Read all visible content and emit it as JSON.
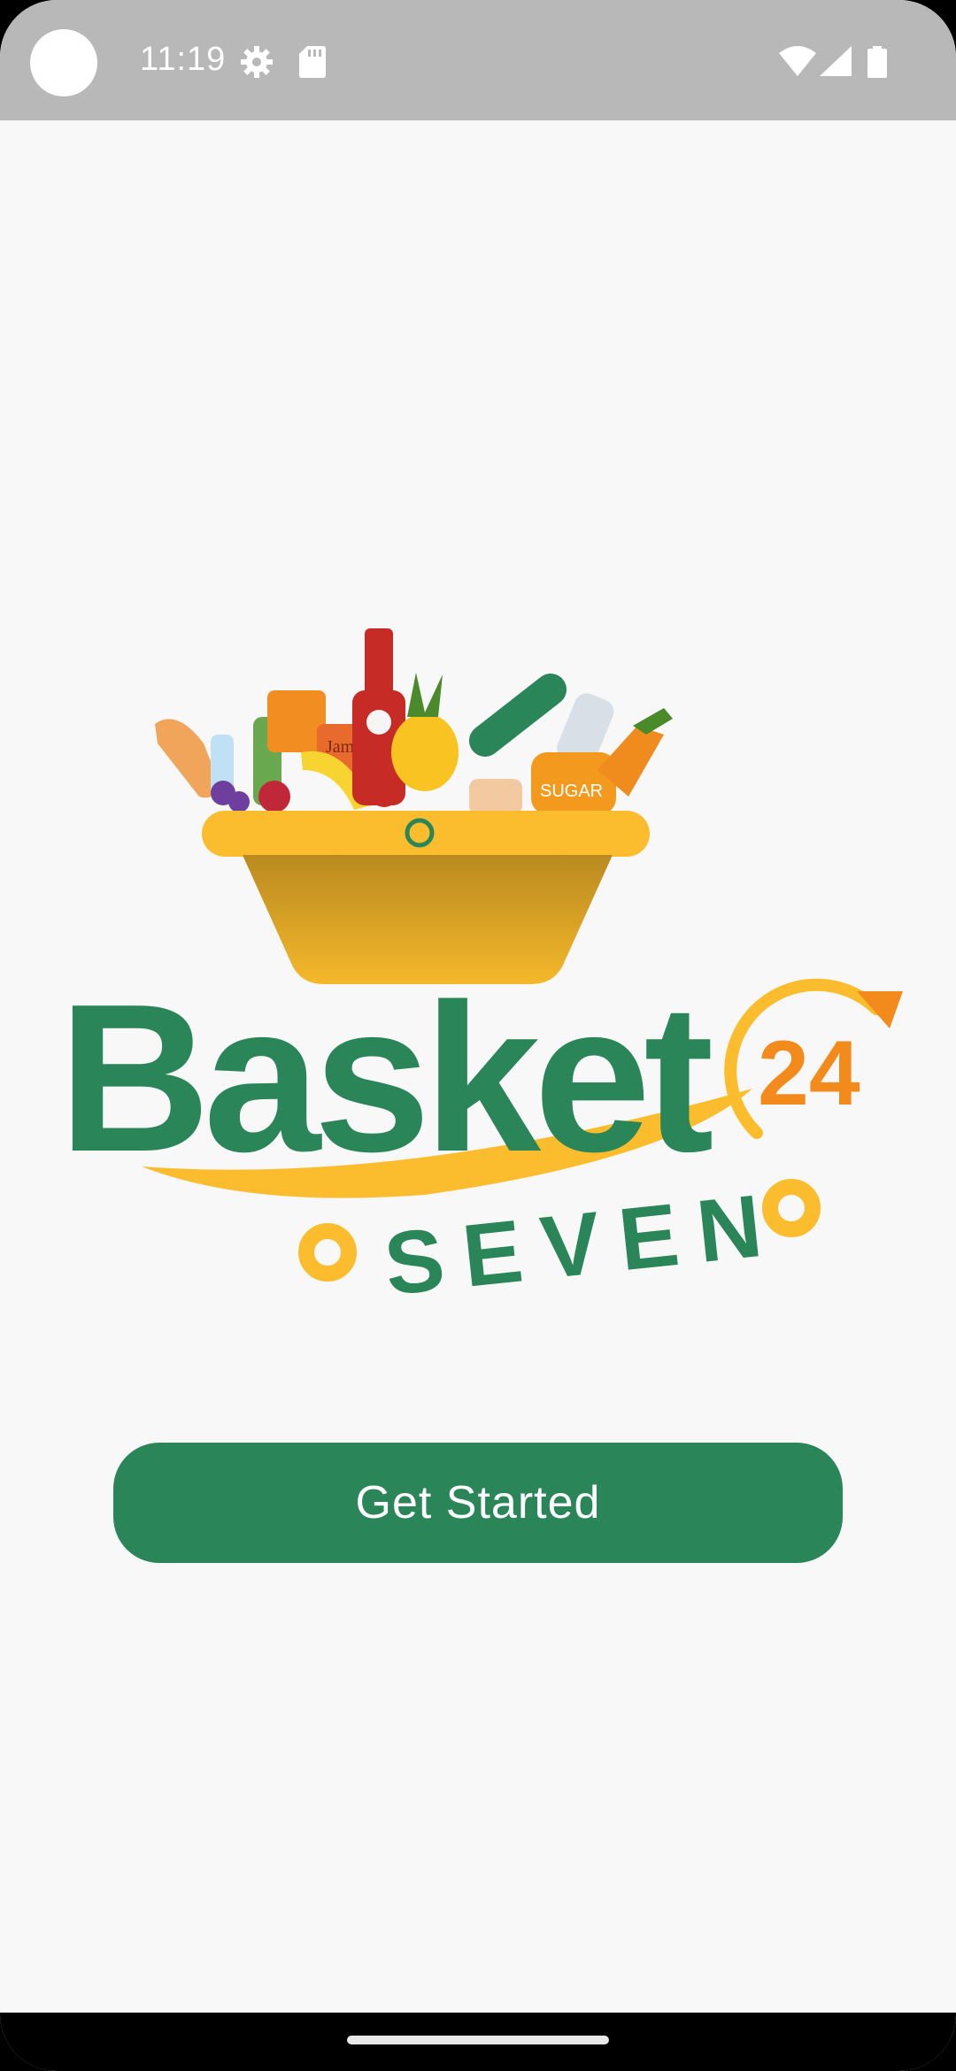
{
  "status_bar": {
    "time": "11:19",
    "icons": [
      "gear-icon",
      "sd-card-icon",
      "wifi-icon",
      "signal-icon",
      "battery-icon"
    ]
  },
  "logo": {
    "wordmark": "Basket",
    "number": "24",
    "subtitle": "SEVEN",
    "jar_label": "Jam",
    "bag_label": "SUGAR",
    "colors": {
      "green": "#2a8659",
      "yellow": "#fbbd2e",
      "orange": "#f38a1c"
    }
  },
  "main": {
    "cta_label": "Get Started"
  },
  "colors": {
    "status_bar": "#b8b8b8",
    "background": "#f8f8f8",
    "button": "#2a8659"
  }
}
